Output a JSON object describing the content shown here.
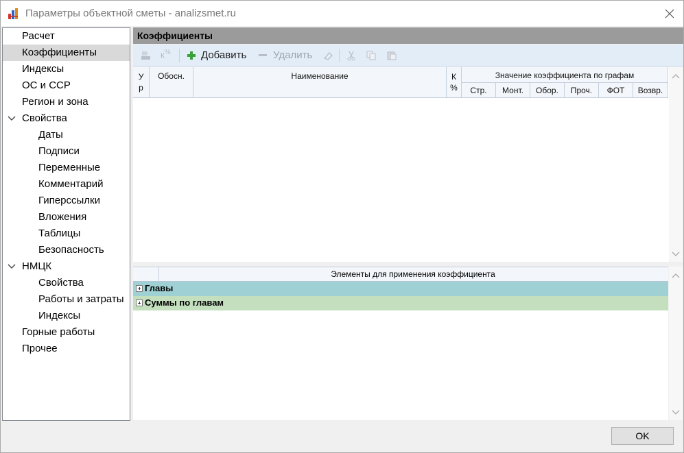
{
  "window": {
    "title": "Параметры объектной сметы - analizsmet.ru"
  },
  "sidebar": {
    "items": [
      {
        "label": "Расчет",
        "level": 0,
        "selected": false
      },
      {
        "label": "Коэффициенты",
        "level": 0,
        "selected": true
      },
      {
        "label": "Индексы",
        "level": 0,
        "selected": false
      },
      {
        "label": "ОС и ССР",
        "level": 0,
        "selected": false
      },
      {
        "label": "Регион и зона",
        "level": 0,
        "selected": false
      },
      {
        "label": "Свойства",
        "level": 0,
        "expanded": true
      },
      {
        "label": "Даты",
        "level": 1
      },
      {
        "label": "Подписи",
        "level": 1
      },
      {
        "label": "Переменные",
        "level": 1
      },
      {
        "label": "Комментарий",
        "level": 1
      },
      {
        "label": "Гиперссылки",
        "level": 1
      },
      {
        "label": "Вложения",
        "level": 1
      },
      {
        "label": "Таблицы",
        "level": 1
      },
      {
        "label": "Безопасность",
        "level": 1
      },
      {
        "label": "НМЦК",
        "level": 0,
        "expanded": true
      },
      {
        "label": "Свойства",
        "level": 1
      },
      {
        "label": "Работы и затраты",
        "level": 1
      },
      {
        "label": "Индексы",
        "level": 1
      },
      {
        "label": "Горные работы",
        "level": 0
      },
      {
        "label": "Прочее",
        "level": 0
      }
    ]
  },
  "main": {
    "section_title": "Коэффициенты",
    "toolbar": {
      "add_label": "Добавить",
      "delete_label": "Удалить",
      "percent_icon_text": "%",
      "k_icon_text": "к"
    },
    "grid": {
      "columns": {
        "level": "У р",
        "basis": "Обосн.",
        "name": "Наименование",
        "k_percent": "К %",
        "values_group": "Значение коэффициента по графам",
        "sub": [
          "Стр.",
          "Монт.",
          "Обор.",
          "Проч.",
          "ФОТ",
          "Возвр."
        ]
      },
      "rows": []
    },
    "elements": {
      "header": "Элементы для применения коэффициента",
      "groups": [
        {
          "label": "Главы",
          "color": "#9fd0d3"
        },
        {
          "label": "Суммы по главам",
          "color": "#c3dfbe"
        }
      ]
    }
  },
  "footer": {
    "ok_label": "OK"
  },
  "colors": {
    "section_header": "#9b9b9b",
    "toolbar_bg": "#e3edf8",
    "selected_item": "#d9d9d9"
  }
}
